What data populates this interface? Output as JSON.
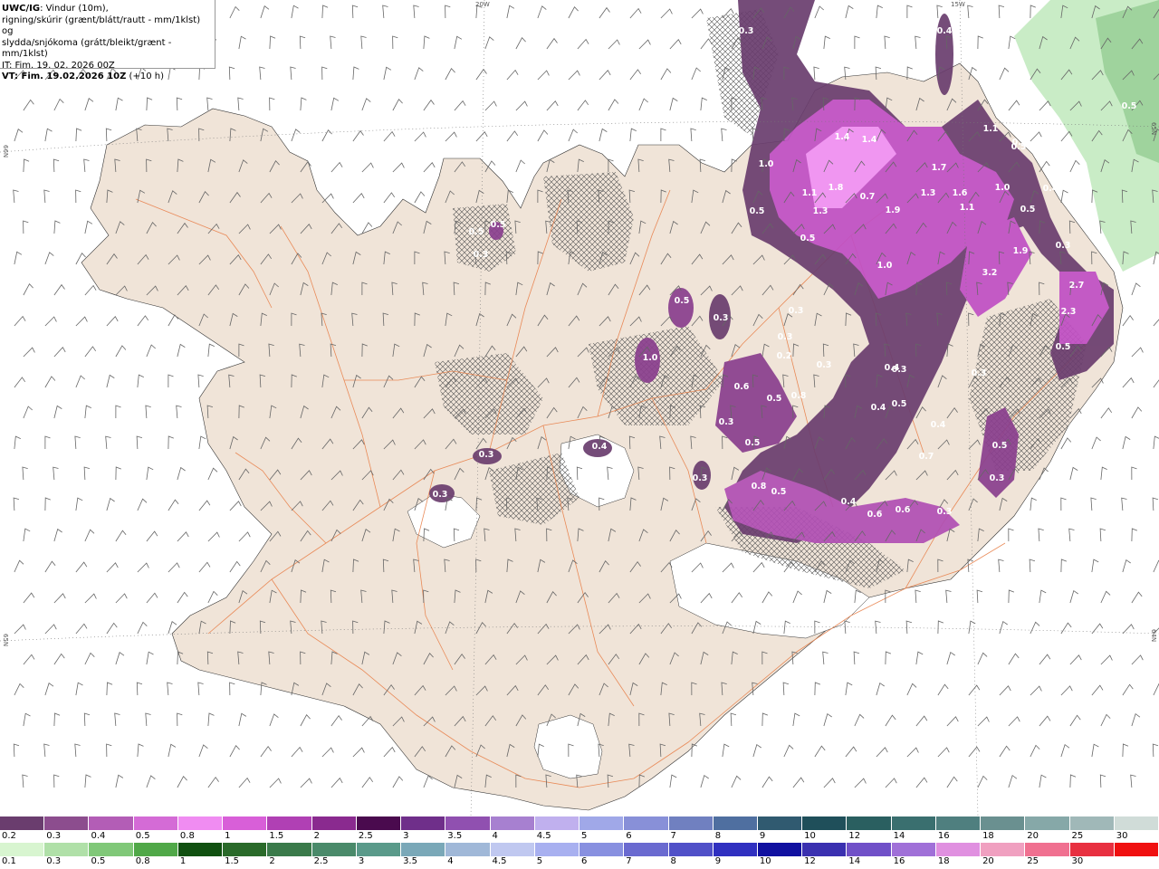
{
  "header": {
    "model": "UWC/IG",
    "desc_line1": ": Vindur (10m),",
    "desc_line2": "rigning/skúrir (grænt/blátt/rautt - mm/1klst) og",
    "desc_line3": "slydda/snjókoma (grátt/bleikt/grænt - mm/1klst)",
    "it_line": "IT: Fim. 19. 02. 2026 00Z",
    "vt_line": "VT: Fim. 19.02.2026 10Z",
    "vt_offset": " (+10 h)"
  },
  "grid_labels": {
    "top_20w": "20W",
    "top_15w": "15W",
    "left_66n": "66N",
    "left_65n": "65N",
    "right_65n": "65N",
    "right_64n": "64N"
  },
  "precip_labels": [
    "0.3",
    "0.4",
    "0.5",
    "0.5",
    "1.1",
    "1.0",
    "1.4",
    "1.4",
    "1.1",
    "1.8",
    "0.7",
    "1.9",
    "1.3",
    "1.6",
    "1.0",
    "1.7",
    "0.5",
    "1.1",
    "1.3",
    "0.5",
    "0.5",
    "1.0",
    "0.4",
    "0.4",
    "0.5",
    "1.9",
    "3.2",
    "2.7",
    "2.3",
    "0.5",
    "0.3",
    "0.5",
    "0.3",
    "1.0",
    "0.3",
    "0.3",
    "0.3",
    "0.2",
    "0.4",
    "0.6",
    "0.5",
    "0.8",
    "0.3",
    "0.5",
    "0.3",
    "0.4",
    "0.5",
    "0.4",
    "0.3",
    "0.5",
    "0.7",
    "0.3",
    "0.3",
    "0.3",
    "0.6",
    "0.8",
    "0.5",
    "0.4",
    "0.6",
    "0.3",
    "0.3",
    "0.4",
    "0.5",
    "0.5",
    "0.3",
    "0.5"
  ],
  "legend_snow": {
    "labels": [
      "0.2",
      "0.3",
      "0.4",
      "0.5",
      "0.8",
      "1",
      "1.5",
      "2",
      "2.5",
      "3",
      "3.5",
      "4",
      "4.5",
      "5",
      "6",
      "7",
      "8",
      "9",
      "10",
      "12",
      "14",
      "16",
      "18",
      "20",
      "25",
      "30"
    ],
    "colors": [
      "#6a3d6e",
      "#8c4d8e",
      "#b35db6",
      "#d46bd6",
      "#f08cf2",
      "#d85fd8",
      "#b040b4",
      "#8a2a8f",
      "#4a0a4e",
      "#6f2f8a",
      "#9050b0",
      "#a780d0",
      "#c0b0ee",
      "#a0a8e8",
      "#8890d8",
      "#7080c0",
      "#4f6fa0",
      "#305a70",
      "#1f4f5a",
      "#2a5f60",
      "#3a6f6f",
      "#4f7f7f",
      "#6a9090",
      "#86a8a8",
      "#a0b8b8",
      "#d0dcd8"
    ]
  },
  "legend_rain": {
    "labels": [
      "0.1",
      "0.3",
      "0.5",
      "0.8",
      "1",
      "1.5",
      "2",
      "2.5",
      "3",
      "3.5",
      "4",
      "4.5",
      "5",
      "6",
      "7",
      "8",
      "9",
      "10",
      "12",
      "14",
      "16",
      "18",
      "20",
      "25",
      "30"
    ],
    "colors": [
      "#d8f5d0",
      "#b0e0a8",
      "#80c878",
      "#50a848",
      "#105010",
      "#2a6a2a",
      "#3a7a4a",
      "#4a8a6a",
      "#5a9a8a",
      "#7aa8b8",
      "#a0b8d8",
      "#c0c8f0",
      "#a8b0f0",
      "#8890e0",
      "#6a6ad0",
      "#5050c8",
      "#3030c0",
      "#1010a0",
      "#3a30b0",
      "#7050c8",
      "#a070d8",
      "#e090e0",
      "#f0a0c0",
      "#f07090",
      "#e83040",
      "#f01010"
    ]
  },
  "colors": {
    "land": "#f0e4d8",
    "road": "#e8804a",
    "snow_light": "#d45fd6",
    "snow_dark": "#5a2a5e",
    "snow_mid": "#8a3f8e",
    "rain_green": "#bfe8c0"
  }
}
